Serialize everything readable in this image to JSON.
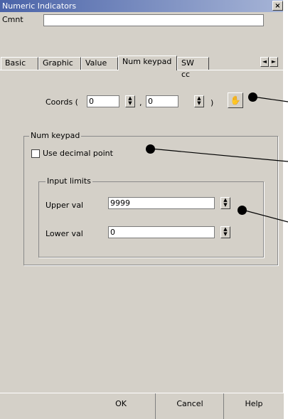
{
  "window": {
    "title": "Numeric Indicators",
    "close_label": "×"
  },
  "cmnt": {
    "label": "Cmnt",
    "value": ""
  },
  "tabs": [
    {
      "label": "Basic"
    },
    {
      "label": "Graphic"
    },
    {
      "label": "Value"
    },
    {
      "label": "Num keypad"
    },
    {
      "label": "SW cc"
    }
  ],
  "tab_scroll": {
    "left": "◄",
    "right": "►"
  },
  "coords": {
    "label": "Coords (",
    "x_value": "0",
    "separator": ",",
    "y_value": "0",
    "close_paren": ")",
    "pick_icon": "pick-position-icon"
  },
  "num_keypad": {
    "group_title": "Num keypad",
    "use_decimal_label": "Use decimal point",
    "use_decimal_checked": false,
    "input_limits": {
      "group_title": "Input limits",
      "upper_label": "Upper val",
      "upper_value": "9999",
      "lower_label": "Lower val",
      "lower_value": "0"
    }
  },
  "buttons": {
    "ok": "OK",
    "cancel": "Cancel",
    "help": "Help"
  }
}
